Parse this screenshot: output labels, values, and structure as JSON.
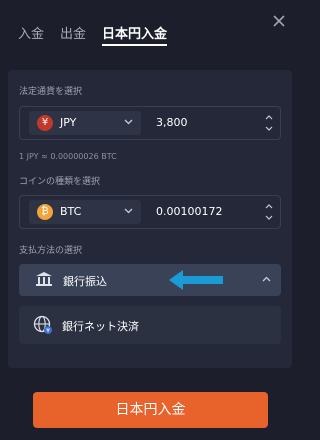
{
  "tabs": [
    {
      "label": "入金"
    },
    {
      "label": "出金"
    },
    {
      "label": "日本円入金"
    }
  ],
  "fiat": {
    "label": "法定通貨を選択",
    "currency_symbol": "¥",
    "currency": "JPY",
    "amount": "3,800",
    "rate": "1 JPY ≈ 0.00000026 BTC"
  },
  "coin": {
    "label": "コインの種類を選択",
    "currency_symbol": "₿",
    "currency": "BTC",
    "amount": "0.00100172"
  },
  "payment": {
    "label": "支払方法の選択",
    "selected": "銀行振込",
    "options": [
      {
        "label": "銀行ネット決済"
      }
    ]
  },
  "submit_label": "日本円入金",
  "colors": {
    "background": "#1c1f2b",
    "panel": "#242838",
    "accent_orange": "#e8622c",
    "jpy_icon": "#c0392b",
    "btc_icon": "#f2a33a",
    "arrow": "#1b9bd6"
  }
}
